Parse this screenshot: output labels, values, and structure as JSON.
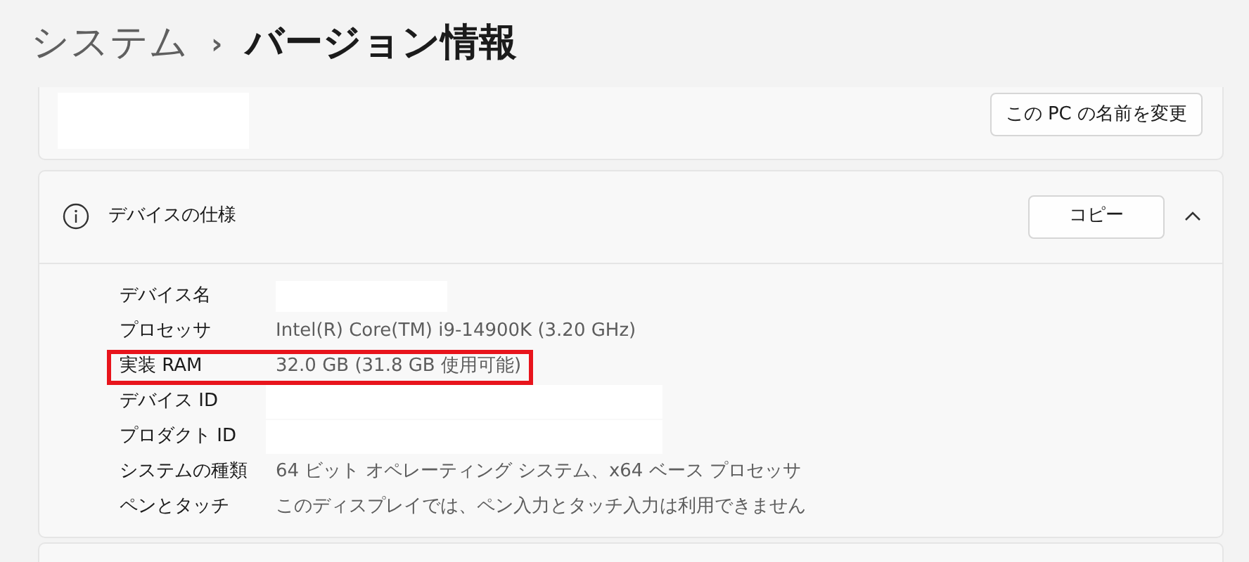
{
  "breadcrumb": {
    "parent": "システム",
    "separator": "›",
    "current": "バージョン情報"
  },
  "device_card": {
    "rename_button": "この PC の名前を変更"
  },
  "specs": {
    "title": "デバイスの仕様",
    "copy_button": "コピー",
    "expanded": true,
    "rows": [
      {
        "label": "デバイス名",
        "highlighted": false
      },
      {
        "label": "プロセッサ",
        "value": "Intel(R) Core(TM) i9-14900K (3.20 GHz)",
        "highlighted": false
      },
      {
        "label": "実装 RAM",
        "value": "32.0 GB (31.8 GB 使用可能)",
        "highlighted": true
      },
      {
        "label": "デバイス ID",
        "highlighted": false
      },
      {
        "label": "プロダクト ID",
        "highlighted": false
      },
      {
        "label": "システムの種類",
        "value": "64 ビット オペレーティング システム、x64 ベース プロセッサ",
        "highlighted": false
      },
      {
        "label": "ペンとタッチ",
        "value": "このディスプレイでは、ペン入力とタッチ入力は利用できません",
        "highlighted": false
      }
    ]
  }
}
